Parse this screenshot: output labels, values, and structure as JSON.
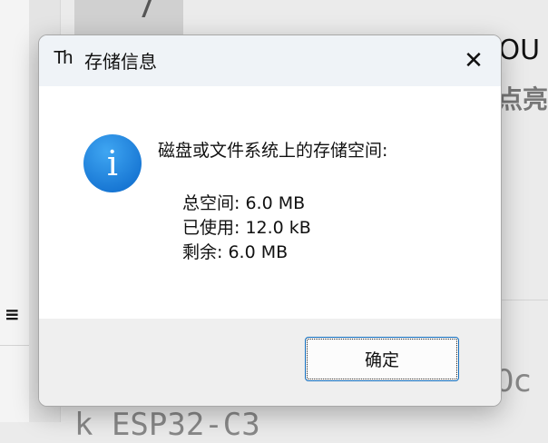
{
  "background": {
    "frag_top": "7",
    "frag_right1": ".OU",
    "frag_right2": "点亮",
    "frag_menu": "≡",
    "frag_right3": "0c",
    "frag_bottom": "k ESP32-C3"
  },
  "dialog": {
    "app_icon": "Th",
    "title": "存储信息",
    "close_icon": "close-icon",
    "info_icon": "info-icon",
    "heading": "磁盘或文件系统上的存储空间:",
    "lines": [
      "总空间: 6.0 MB",
      "已使用: 12.0 kB",
      "剩余: 6.0 MB"
    ],
    "ok_label": "确定"
  },
  "colors": {
    "accent": "#0f6cbd",
    "info": "#1a7fdc"
  }
}
